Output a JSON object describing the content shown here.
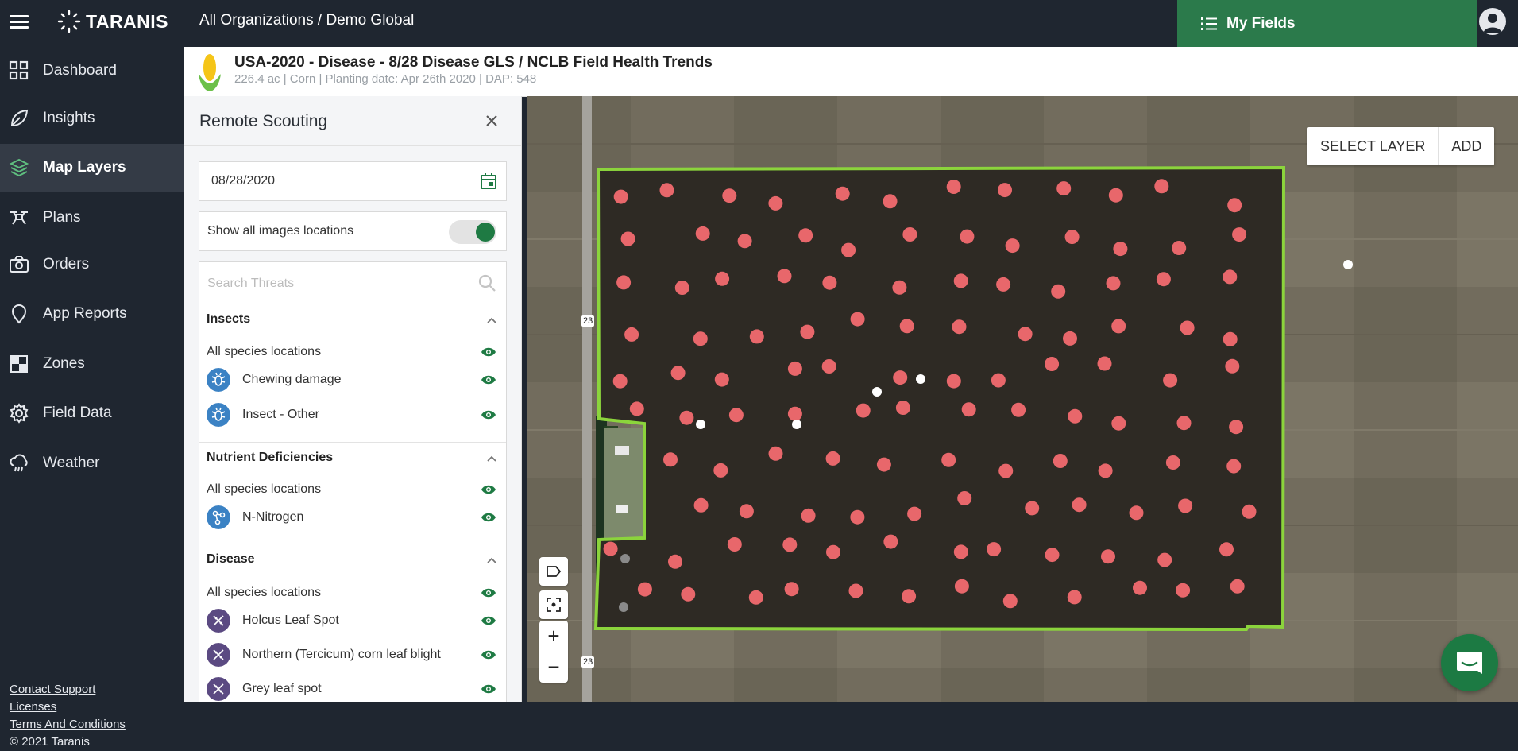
{
  "topbar": {
    "logo_text": "TARANIS",
    "breadcrumb": "All Organizations / Demo Global",
    "my_fields_label": "My Fields"
  },
  "sidebar": {
    "items": [
      {
        "label": "Dashboard",
        "icon": "grid-icon"
      },
      {
        "label": "Insights",
        "icon": "leaf-icon"
      },
      {
        "label": "Map Layers",
        "icon": "layers-icon",
        "active": true
      },
      {
        "label": "Plans",
        "icon": "drone-icon"
      },
      {
        "label": "Orders",
        "icon": "camera-icon"
      },
      {
        "label": "App Reports",
        "icon": "map-pin-icon"
      },
      {
        "label": "Zones",
        "icon": "checkerboard-icon"
      },
      {
        "label": "Field Data",
        "icon": "gear-icon"
      },
      {
        "label": "Weather",
        "icon": "cloud-rain-icon"
      }
    ],
    "footer": {
      "contact": "Contact Support",
      "licenses": "Licenses",
      "terms": "Terms And Conditions",
      "copyright": "© 2021 Taranis"
    }
  },
  "field": {
    "title": "USA-2020 - Disease - 8/28 Disease GLS / NCLB Field Health Trends",
    "meta": "226.4 ac | Corn | Planting date: Apr 26th 2020 | DAP: 548"
  },
  "panel": {
    "title": "Remote Scouting",
    "date": "08/28/2020",
    "show_all_label": "Show all images locations",
    "show_all_on": true,
    "search_placeholder": "Search Threats",
    "sections": [
      {
        "title": "Insects",
        "all_label": "All species locations",
        "items": [
          {
            "label": "Chewing damage",
            "icon": "bug-icon",
            "color": "#3b82c4"
          },
          {
            "label": "Insect - Other",
            "icon": "bug-icon",
            "color": "#3b82c4"
          }
        ]
      },
      {
        "title": "Nutrient Deficiencies",
        "all_label": "All species locations",
        "items": [
          {
            "label": "N-Nitrogen",
            "icon": "molecule-icon",
            "color": "#3b82c4"
          }
        ]
      },
      {
        "title": "Disease",
        "all_label": "All species locations",
        "items": [
          {
            "label": "Holcus Leaf Spot",
            "icon": "dna-icon",
            "color": "#5b4a82"
          },
          {
            "label": "Northern (Tercicum) corn leaf blight",
            "icon": "dna-icon",
            "color": "#5b4a82"
          },
          {
            "label": "Grey leaf spot",
            "icon": "dna-icon",
            "color": "#5b4a82"
          }
        ]
      }
    ]
  },
  "map": {
    "select_layer": "SELECT LAYER",
    "add": "ADD",
    "road_label": "23",
    "boundary_color": "#8bd43c",
    "point_color": "#e8676b",
    "point_count_red": 118,
    "point_count_white": 5,
    "point_count_grey": 2
  },
  "colors": {
    "brand_green": "#2b7a4b",
    "sidebar_bg": "#1f2630",
    "sidebar_active": "#343b46"
  }
}
